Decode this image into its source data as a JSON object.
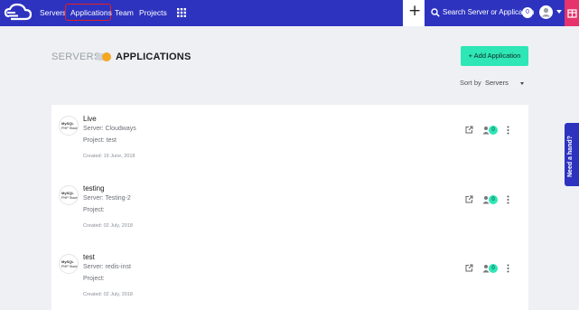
{
  "nav": {
    "servers": "Servers",
    "applications": "Applications",
    "team": "Team",
    "projects": "Projects"
  },
  "search": {
    "placeholder": "Search Server or Application"
  },
  "notifications": {
    "count": "0"
  },
  "breadcrumb": {
    "servers": "SERVERS",
    "applications": "APPLICATIONS"
  },
  "add_button": {
    "label": "+ Add Application"
  },
  "sort": {
    "label": "Sort by",
    "value": "Servers"
  },
  "apps": [
    {
      "name": "Live",
      "server": "Server: Cloudways",
      "project": "Project: test",
      "created": "Created: 19 June, 2018",
      "logo_line1": "MySQL",
      "logo_line2": "PHP Stack",
      "users": "0"
    },
    {
      "name": "testing",
      "server": "Server: Testing-2",
      "project": "Project:",
      "created": "Created: 02 July, 2018",
      "logo_line1": "MySQL",
      "logo_line2": "PHP Stack",
      "users": "0"
    },
    {
      "name": "test",
      "server": "Server: redis-inst",
      "project": "Project:",
      "created": "Created: 02 July, 2018",
      "logo_line1": "MySQL",
      "logo_line2": "PHP Stack",
      "users": "0"
    }
  ],
  "help": {
    "label": "Need a hand?"
  },
  "colors": {
    "primary": "#2d33bf",
    "accent": "#2ee6b6",
    "highlight": "#e02020",
    "toggle": "#f5a623",
    "gift": "#e6336b"
  },
  "icons": [
    "cloud-logo-icon",
    "grid-icon",
    "plus-icon",
    "search-icon",
    "user-avatar-icon",
    "chevron-down-icon",
    "gift-icon",
    "external-link-icon",
    "user-icon",
    "more-vertical-icon"
  ]
}
